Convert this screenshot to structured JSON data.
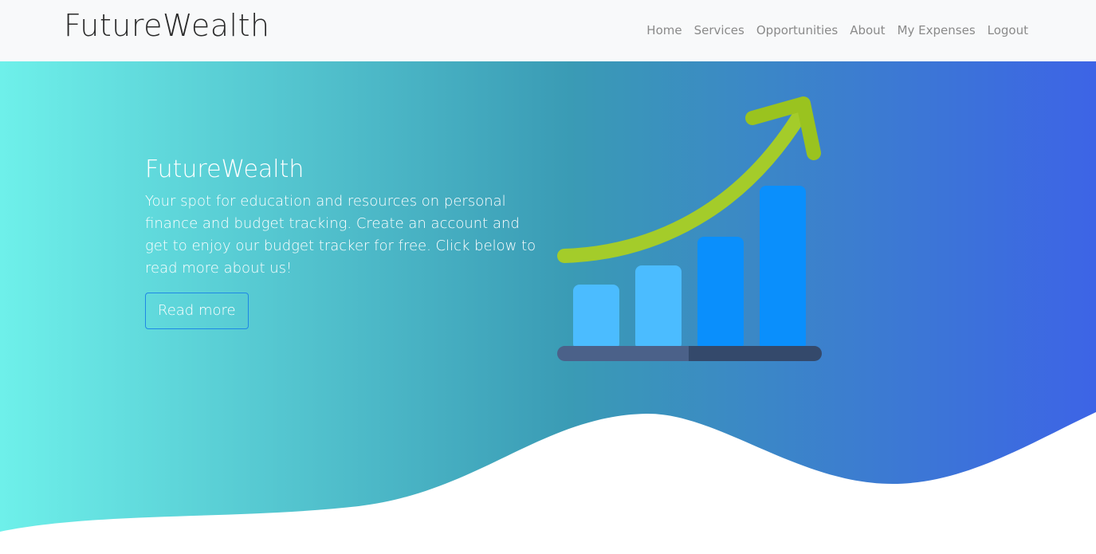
{
  "navbar": {
    "brand": "FutureWealth",
    "links": [
      "Home",
      "Services",
      "Opportunities",
      "About",
      "My Expenses",
      "Logout"
    ]
  },
  "hero": {
    "title": "FutureWealth",
    "description": "Your spot for education and resources on personal finance and budget tracking. Create an account and get to enjoy our budget tracker for free. Click below to read more about us!",
    "button_label": "Read more",
    "illustration_icon": "growth-bar-chart-icon"
  },
  "colors": {
    "gradient_start": "#6ef0ea",
    "gradient_mid": "#3a9bb5",
    "gradient_end": "#3d64e6",
    "button_border": "#1e88e5",
    "arrow_green": "#a4cc2a",
    "bar_light": "#4bbcff",
    "bar_dark": "#0a8ffc"
  }
}
